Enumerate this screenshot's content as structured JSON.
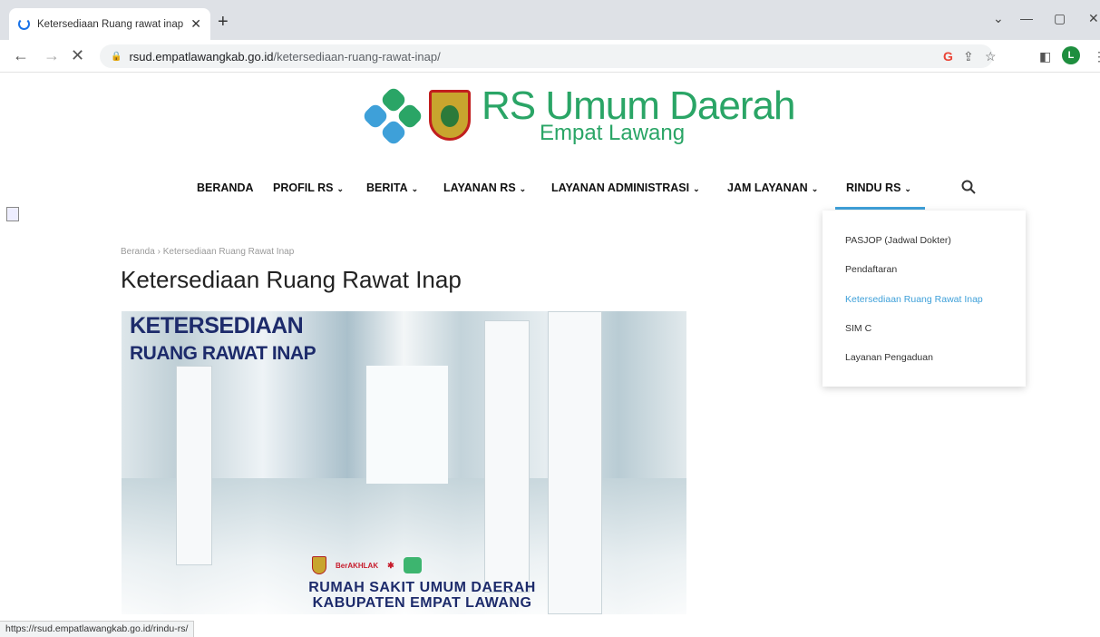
{
  "browser": {
    "tab_title": "Ketersediaan Ruang rawat inap R",
    "url_host": "rsud.empatlawangkab.go.id",
    "url_path": "/ketersediaan-ruang-rawat-inap/",
    "profile_initial": "L",
    "status_url": "https://rsud.empatlawangkab.go.id/rindu-rs/"
  },
  "logo": {
    "main": "RS Umum Daerah",
    "sub": "Empat Lawang",
    "colors": {
      "green": "#2aa566",
      "blue": "#3ea0d9"
    }
  },
  "nav": {
    "items": [
      {
        "label": "BERANDA"
      },
      {
        "label": "PROFIL RS",
        "chevron": "⌄"
      },
      {
        "label": "BERITA",
        "chevron": "⌄"
      },
      {
        "label": "LAYANAN RS",
        "chevron": "⌄"
      },
      {
        "label": "LAYANAN ADMINISTRASI",
        "chevron": "⌄"
      },
      {
        "label": "JAM LAYANAN",
        "chevron": "⌄"
      },
      {
        "label": "RINDU RS",
        "chevron": "⌄"
      }
    ],
    "accent": "#3ea0d9"
  },
  "dropdown": {
    "items": [
      {
        "label": "PASJOP (Jadwal Dokter)"
      },
      {
        "label": "Pendaftaran"
      },
      {
        "label": "Ketersediaan Ruang Rawat Inap",
        "active": true
      },
      {
        "label": "SIM C"
      },
      {
        "label": "Layanan Pengaduan"
      }
    ]
  },
  "breadcrumb": {
    "home": "Beranda",
    "sep": "›",
    "current": "Ketersediaan Ruang Rawat Inap"
  },
  "page": {
    "title": "Ketersediaan Ruang Rawat Inap"
  },
  "hero": {
    "heading_line1": "KETERSEDIAAN",
    "heading_line2": "RUANG RAWAT INAP",
    "partner2": "BerAKHLAK",
    "footer_line1": "RUMAH SAKIT UMUM DAERAH",
    "footer_line2": "KABUPATEN EMPAT LAWANG"
  }
}
